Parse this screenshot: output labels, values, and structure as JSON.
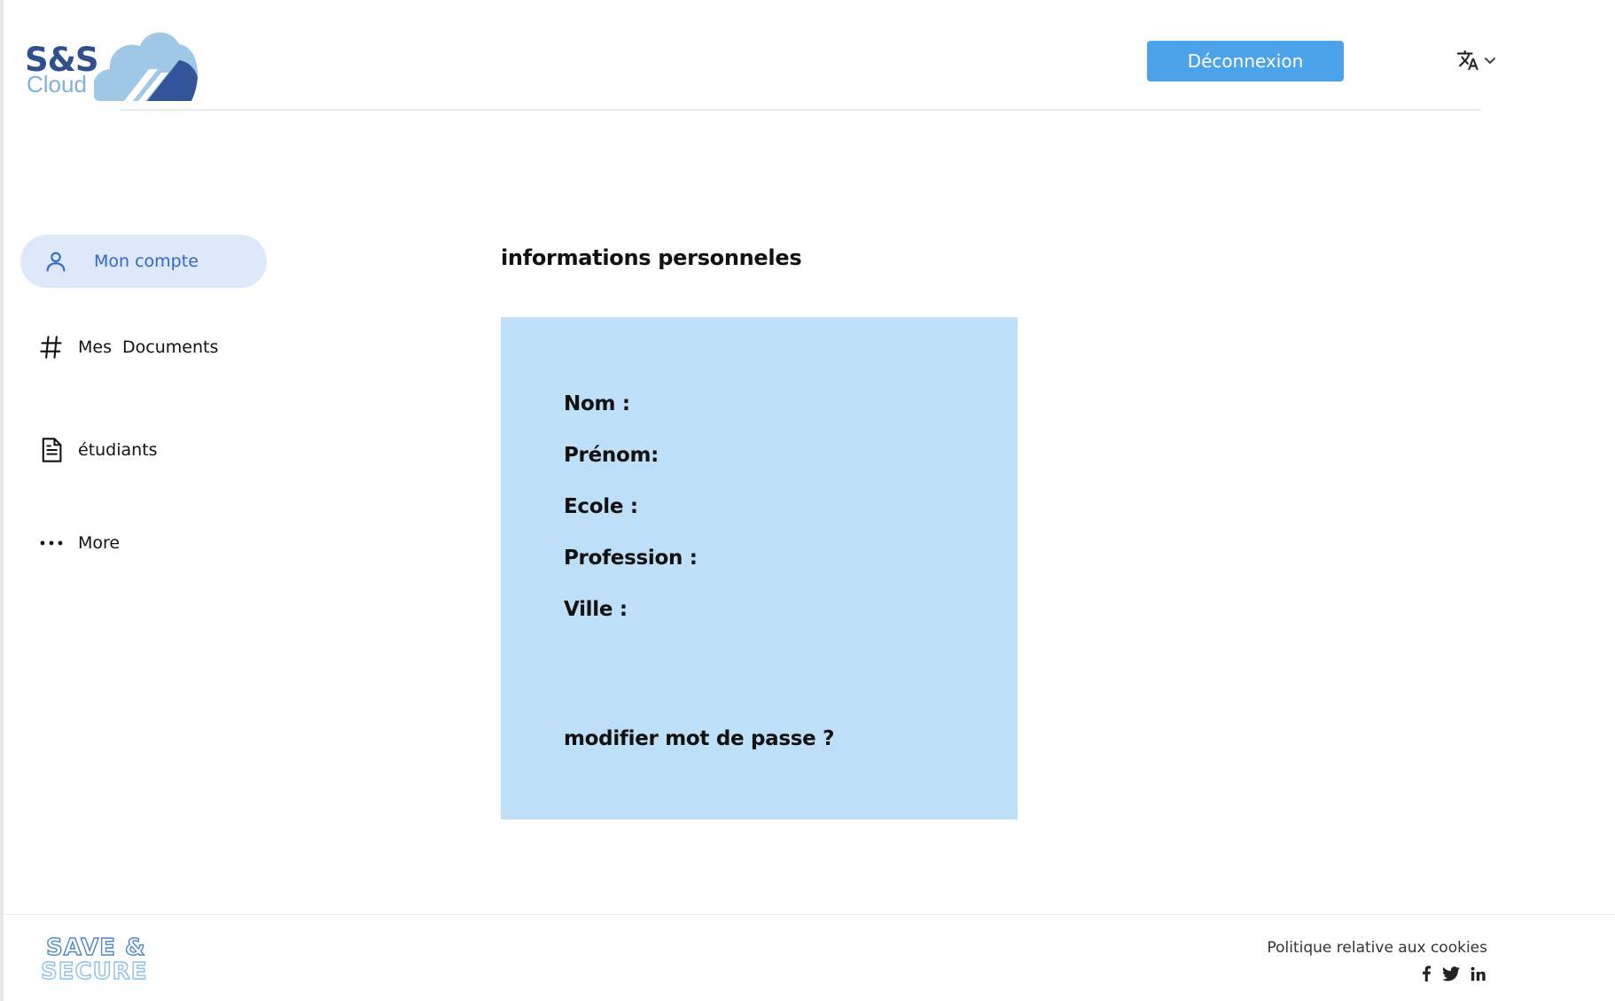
{
  "brand": {
    "logo_abbrev": "S&S",
    "logo_word": "Cloud",
    "footer_logo_line1": "SAVE &",
    "footer_logo_line2": "SECURE"
  },
  "header": {
    "logout_label": "Déconnexion",
    "language_icon": "translate-icon",
    "language_chevron": "chevron-down-icon"
  },
  "sidebar": {
    "items": [
      {
        "label": "Mon compte",
        "icon": "user-icon",
        "active": true
      },
      {
        "label": "Mes  Documents",
        "icon": "hash-icon",
        "active": false
      },
      {
        "label": "étudiants",
        "icon": "document-icon",
        "active": false
      },
      {
        "label": "More",
        "icon": "more-dots-icon",
        "active": false
      }
    ]
  },
  "main": {
    "title": "informations personneles",
    "fields": {
      "nom": "Nom :",
      "prenom": "Prénom:",
      "ecole": "Ecole :",
      "profession": "Profession :",
      "ville": "Ville :"
    },
    "change_password": "modifier mot de passe ?"
  },
  "footer": {
    "cookie_policy": "Politique relative aux cookies",
    "social": [
      "facebook-icon",
      "twitter-icon",
      "linkedin-icon"
    ]
  },
  "colors": {
    "primary_button": "#4da3ea",
    "active_nav_bg": "#dde8fb",
    "active_nav_text": "#2f67cc",
    "card_bg": "#bddff7",
    "logo_dark": "#2f4f8f",
    "logo_light": "#7fb2da"
  }
}
